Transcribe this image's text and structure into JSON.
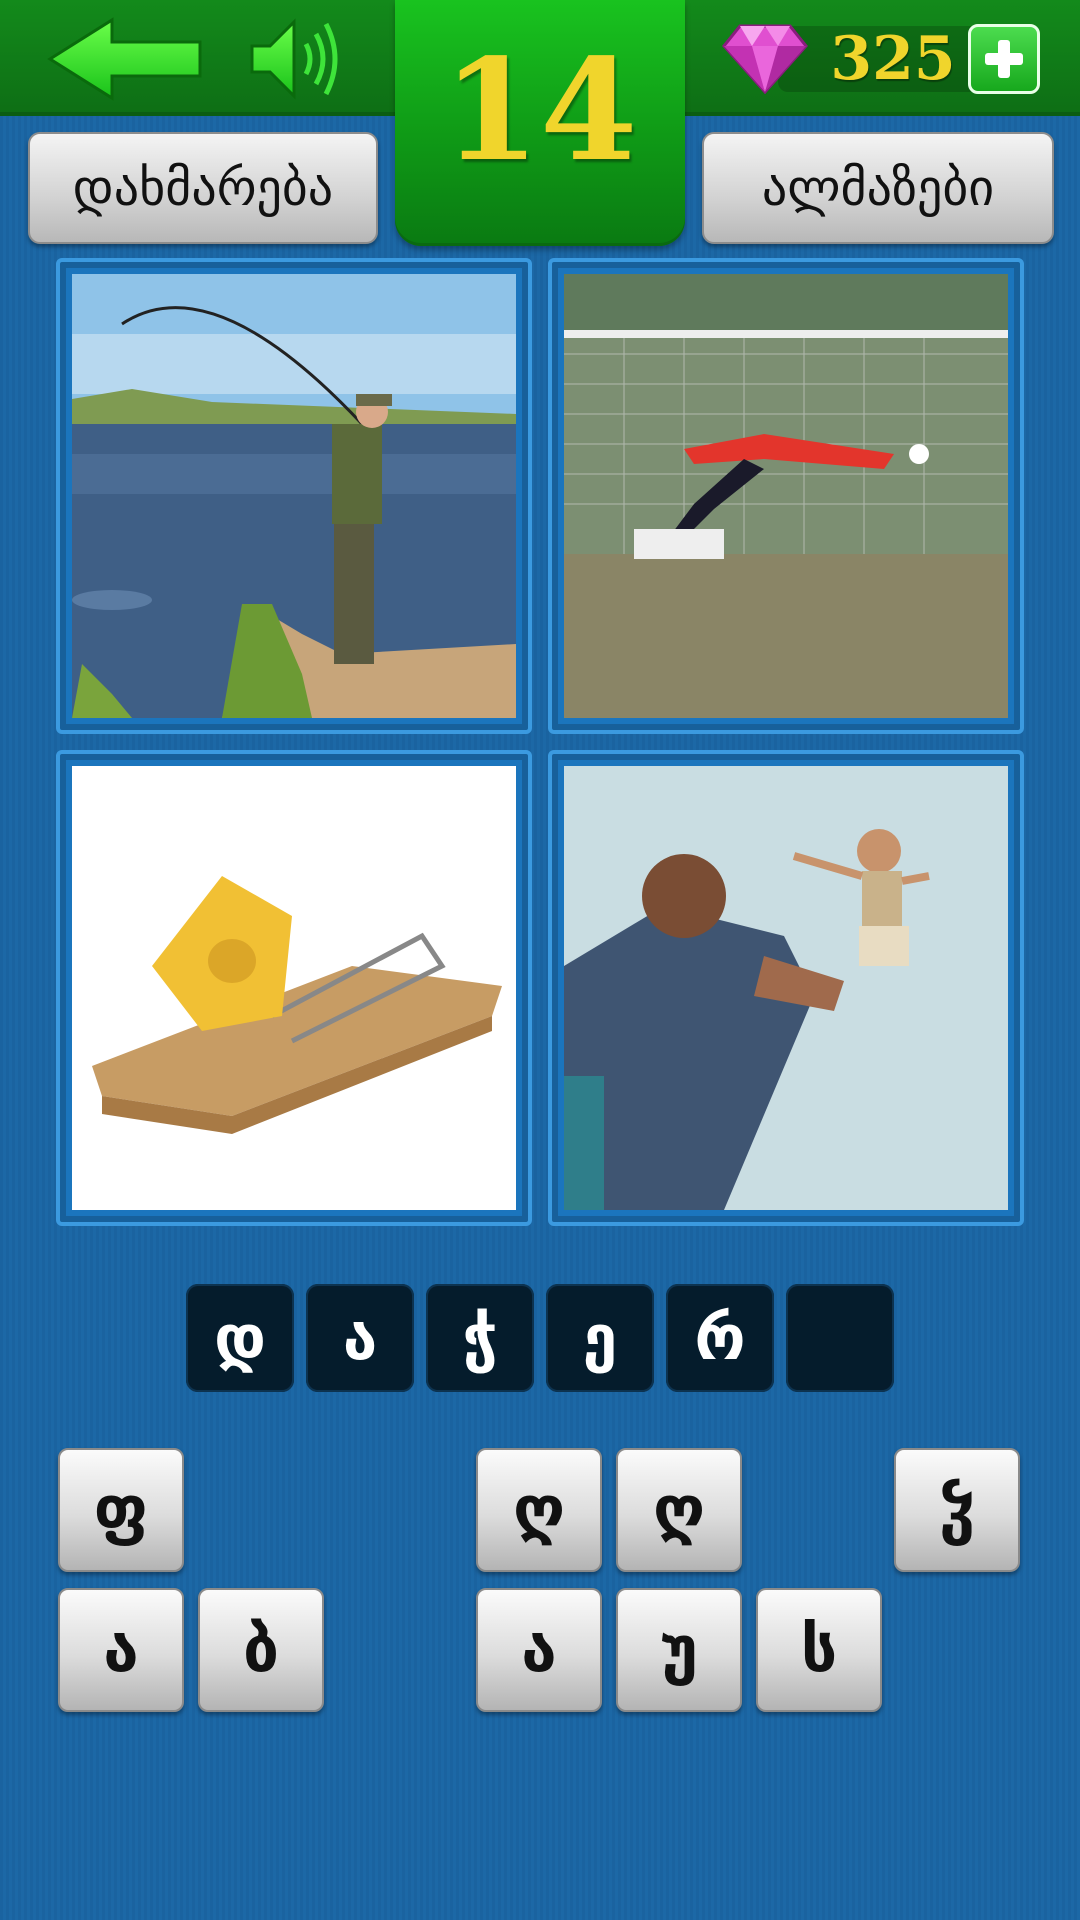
{
  "header": {
    "level": "14",
    "gem_count": "325",
    "back_icon": "back-arrow-icon",
    "sound_icon": "speaker-icon",
    "gem_icon": "diamond-icon",
    "add_icon": "plus-icon",
    "accent_color": "#f0d52c"
  },
  "buttons": {
    "help_label": "დახმარება",
    "gems_label": "ალმაზები"
  },
  "answer": {
    "slots": [
      "დ",
      "ა",
      "ჭ",
      "ე",
      "რ",
      ""
    ]
  },
  "letters": {
    "row1": [
      "ფ",
      "ღ",
      "ღ",
      "ჴ"
    ],
    "row2": [
      "ა",
      "ბ",
      "ა",
      "უ",
      "ს"
    ]
  }
}
